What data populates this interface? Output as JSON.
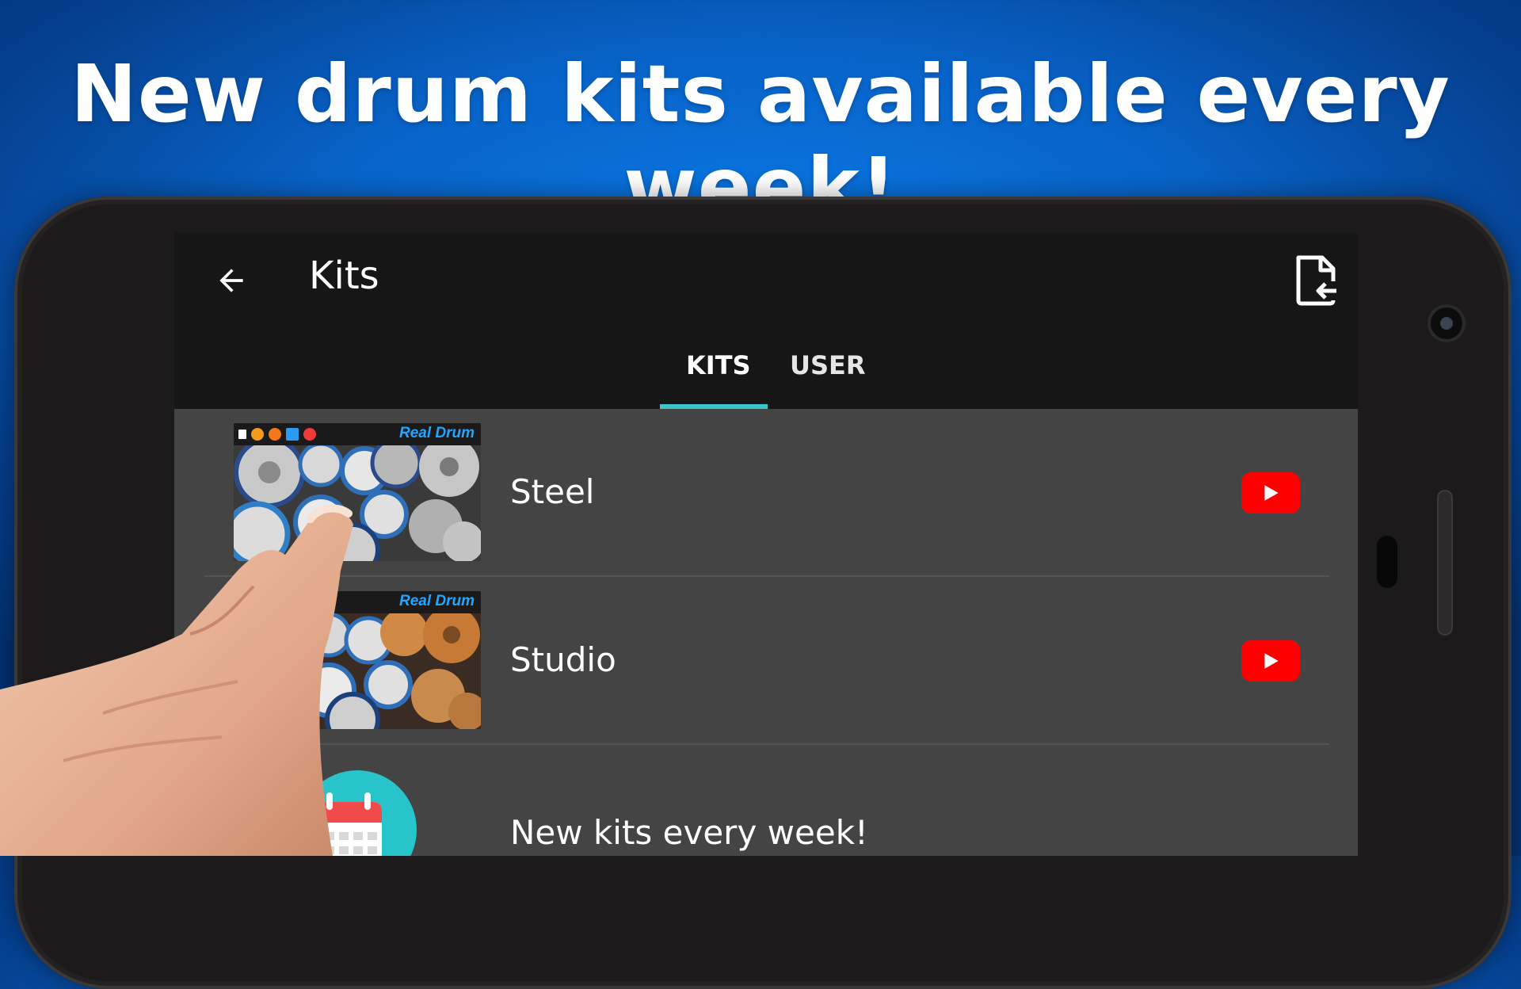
{
  "headline": "New drum kits available every week!",
  "appbar": {
    "title": "Kits",
    "back_icon": "arrow-left-icon",
    "import_icon": "file-import-icon"
  },
  "tabs": [
    {
      "label": "KITS",
      "active": true
    },
    {
      "label": "USER",
      "active": false
    }
  ],
  "kits": [
    {
      "name": "Steel",
      "thumb_brand": "Real Drum",
      "video_icon": "youtube-play-icon"
    },
    {
      "name": "Studio",
      "thumb_brand": "Real Drum",
      "video_icon": "youtube-play-icon"
    }
  ],
  "promo_row": {
    "label": "New kits every week!",
    "icon": "calendar-icon"
  },
  "colors": {
    "accent": "#3bc5c8",
    "youtube": "#ff0000",
    "appbar_bg": "#161616",
    "list_bg": "#444444",
    "background_blue": "#0863c8"
  }
}
